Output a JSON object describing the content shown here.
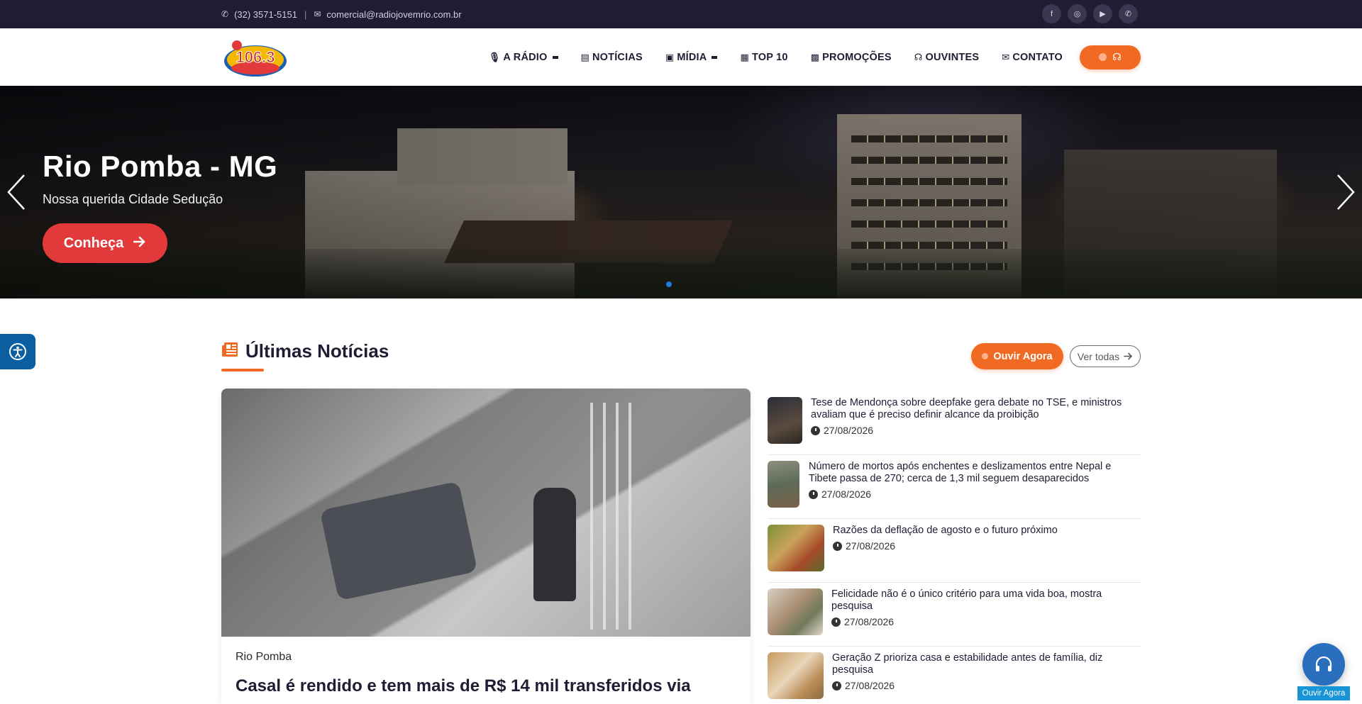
{
  "topbar": {
    "phone": "(32) 3571-5151",
    "separator": "|",
    "email": "comercial@radiojovemrio.com.br",
    "socials": [
      {
        "icon": "facebook-icon",
        "glyph": "f"
      },
      {
        "icon": "instagram-icon",
        "glyph": "◎"
      },
      {
        "icon": "youtube-icon",
        "glyph": "▶"
      },
      {
        "icon": "whatsapp-icon",
        "glyph": "✆"
      }
    ]
  },
  "logo": {
    "text": "106.3"
  },
  "nav": {
    "items": [
      {
        "label": "A RÁDIO",
        "icon": "microphone-icon",
        "glyph": "🎙",
        "dropdown": true
      },
      {
        "label": "NOTÍCIAS",
        "icon": "newspaper-icon",
        "glyph": "▤",
        "dropdown": false
      },
      {
        "label": "MÍDIA",
        "icon": "images-icon",
        "glyph": "▣",
        "dropdown": true
      },
      {
        "label": "TOP 10",
        "icon": "calendar-icon",
        "glyph": "▦",
        "dropdown": false
      },
      {
        "label": "PROMOÇÕES",
        "icon": "gift-icon",
        "glyph": "🎁",
        "dropdown": false
      },
      {
        "label": "OUVINTES",
        "icon": "headphones-icon",
        "glyph": "🎧",
        "dropdown": false
      },
      {
        "label": "CONTATO",
        "icon": "envelope-icon",
        "glyph": "✉",
        "dropdown": false
      }
    ]
  },
  "hero": {
    "title": "Rio Pomba - MG",
    "subtitle": "Nossa querida Cidade Sedução",
    "button": "Conheça"
  },
  "section": {
    "title": "Últimas Notícias",
    "listen_button": "Ouvir Agora",
    "see_all": "Ver todas"
  },
  "featured": {
    "category": "Rio Pomba",
    "headline": "Casal é rendido e tem mais de R$ 14 mil transferidos via"
  },
  "news": [
    {
      "title": "Tese de Mendonça sobre deepfake gera debate no TSE, e ministros avaliam que é preciso definir alcance da proibição",
      "date": "27/08/2026"
    },
    {
      "title": "Número de mortos após enchentes e deslizamentos entre Nepal e Tibete passa de 270; cerca de 1,3 mil seguem desaparecidos",
      "date": "27/08/2026"
    },
    {
      "title": "Razões da deflação de agosto e o futuro próximo",
      "date": "27/08/2026"
    },
    {
      "title": "Felicidade não é o único critério para uma vida boa, mostra pesquisa",
      "date": "27/08/2026"
    },
    {
      "title": "Geração Z prioriza casa e estabilidade antes de família, diz pesquisa",
      "date": "27/08/2026"
    }
  ],
  "player": {
    "label": "Ouvir Agora"
  },
  "colors": {
    "accent": "#f06a24",
    "dark": "#1f1c33",
    "hero_button": "#e23a3a",
    "player": "#2a6fbd"
  }
}
